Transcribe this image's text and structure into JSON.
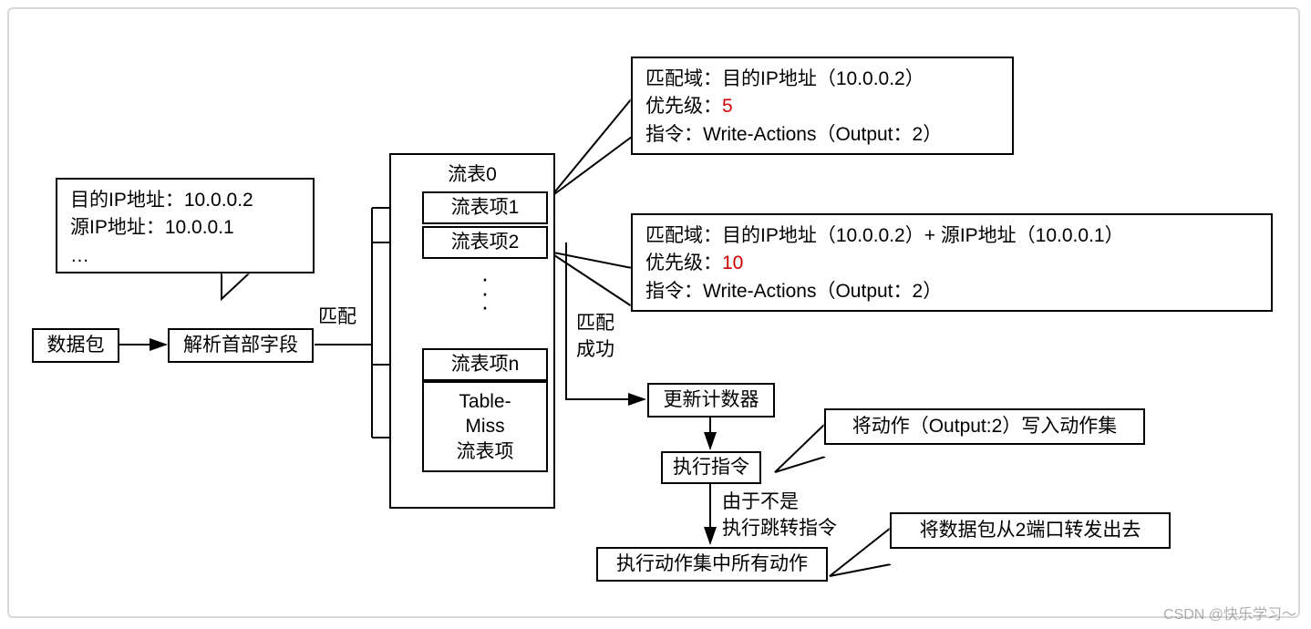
{
  "packet_info": {
    "dst_ip_line": "目的IP地址：10.0.0.2",
    "src_ip_line": "源IP地址：10.0.0.1",
    "ellipsis": "…"
  },
  "nodes": {
    "packet": "数据包",
    "parse_header": "解析首部字段",
    "flow_table_title": "流表0",
    "entry1": "流表项1",
    "entry2": "流表项2",
    "entryn": "流表项n",
    "table_miss": "Table-\nMiss\n流表项",
    "update_counter": "更新计数器",
    "exec_instr": "执行指令",
    "exec_all_actions": "执行动作集中所有动作"
  },
  "edge_labels": {
    "match": "匹配",
    "match_success": "匹配\n成功",
    "not_goto": "由于不是\n执行跳转指令"
  },
  "callouts": {
    "entry1_match": "匹配域：目的IP地址（10.0.0.2）",
    "entry1_prio_label": "优先级：",
    "entry1_prio_val": "5",
    "entry1_instr": "指令：Write-Actions（Output：2）",
    "entry2_match": "匹配域：目的IP地址（10.0.0.2）+ 源IP地址（10.0.0.1）",
    "entry2_prio_label": "优先级：",
    "entry2_prio_val": "10",
    "entry2_instr": "指令：Write-Actions（Output：2）",
    "exec_instr_note": "将动作（Output:2）写入动作集",
    "exec_all_note": "将数据包从2端口转发出去"
  },
  "watermark": "CSDN @快乐学习～"
}
